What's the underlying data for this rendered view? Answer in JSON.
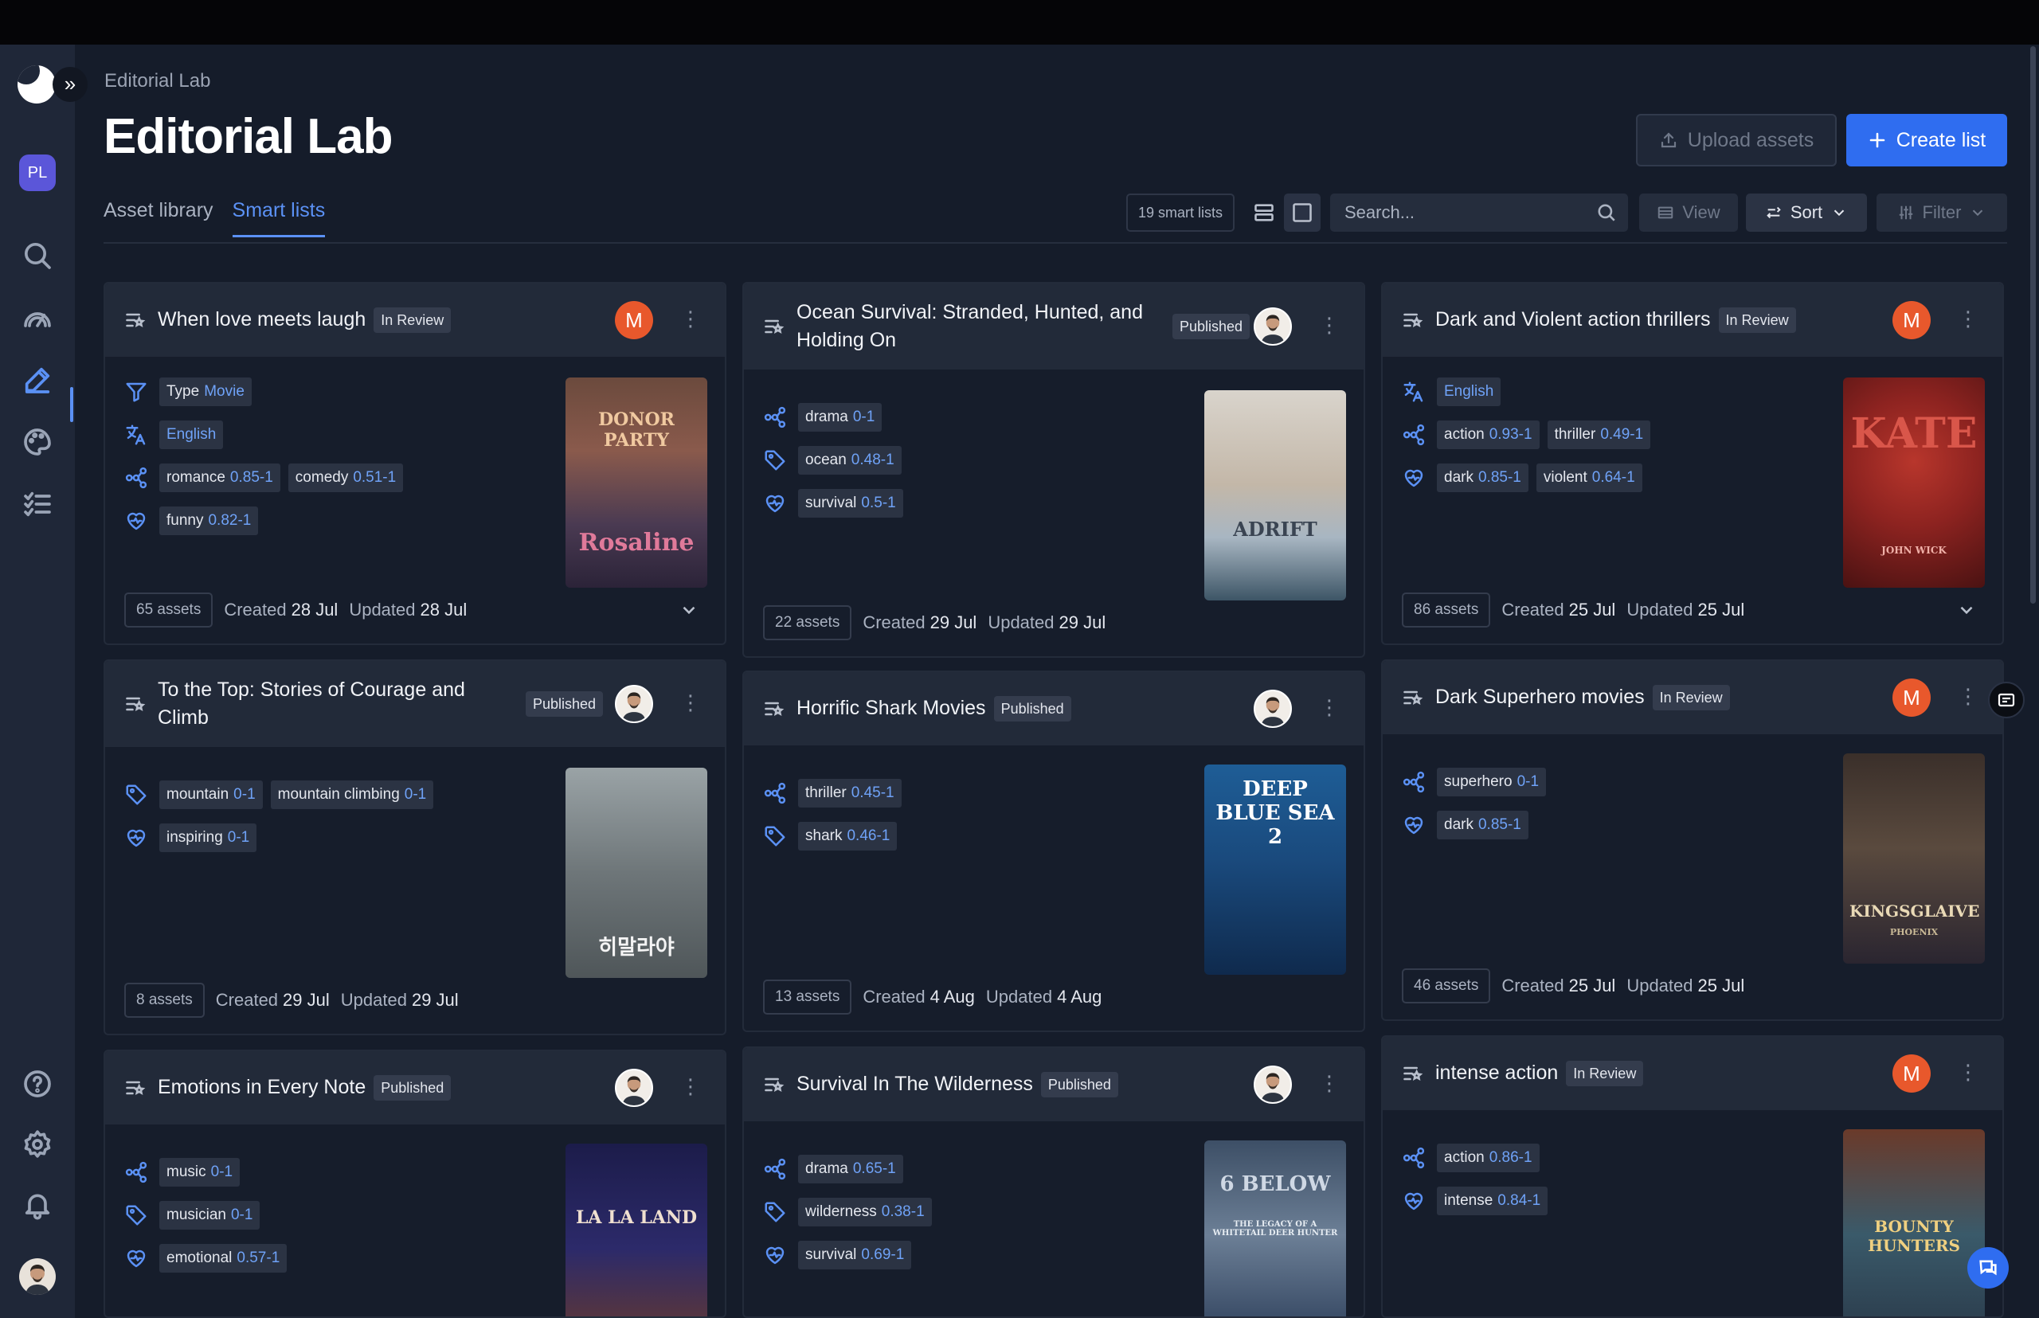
{
  "breadcrumb": "Editorial Lab",
  "page_title": "Editorial Lab",
  "header_actions": {
    "upload": "Upload assets",
    "create": "Create list"
  },
  "sidebar": {
    "workspace_initials": "PL"
  },
  "tabs": [
    {
      "label": "Asset library",
      "active": false
    },
    {
      "label": "Smart lists",
      "active": true
    }
  ],
  "toolbar": {
    "smart_list_count": "19 smart lists",
    "search_placeholder": "Search...",
    "view_label": "View",
    "sort_label": "Sort",
    "filter_label": "Filter"
  },
  "cards": [
    {
      "title": "When love meets laugh",
      "status": "In Review",
      "owner_initial": "M",
      "rows": [
        {
          "icon": "filter-icon",
          "chips": [
            {
              "label": "Type",
              "value": "Movie"
            }
          ]
        },
        {
          "icon": "language-icon",
          "chips": [
            {
              "label": "English"
            }
          ]
        },
        {
          "icon": "genre-icon",
          "chips": [
            {
              "label": "romance",
              "value": "0.85-1"
            },
            {
              "label": "comedy",
              "value": "0.51-1"
            }
          ]
        },
        {
          "icon": "mood-icon",
          "chips": [
            {
              "label": "funny",
              "value": "0.82-1"
            }
          ]
        }
      ],
      "poster": {
        "top_text": "DONOR PARTY",
        "bottom_text": "Rosaline"
      },
      "assets": "65 assets",
      "created_label": "Created",
      "created": "28 Jul",
      "updated_label": "Updated",
      "updated": "28 Jul"
    },
    {
      "title": "Ocean Survival: Stranded, Hunted, and Holding On",
      "status": "Published",
      "rows": [
        {
          "icon": "genre-icon",
          "chips": [
            {
              "label": "drama",
              "value": "0-1"
            }
          ]
        },
        {
          "icon": "tag-icon",
          "chips": [
            {
              "label": "ocean",
              "value": "0.48-1"
            }
          ]
        },
        {
          "icon": "mood-icon",
          "chips": [
            {
              "label": "survival",
              "value": "0.5-1"
            }
          ]
        }
      ],
      "poster": {
        "text": "ADRIFT"
      },
      "assets": "22 assets",
      "created_label": "Created",
      "created": "29 Jul",
      "updated_label": "Updated",
      "updated": "29 Jul"
    },
    {
      "title": "Dark and Violent action thrillers",
      "status": "In Review",
      "owner_initial": "M",
      "rows": [
        {
          "icon": "language-icon",
          "chips": [
            {
              "label": "English"
            }
          ]
        },
        {
          "icon": "genre-icon",
          "chips": [
            {
              "label": "action",
              "value": "0.93-1"
            },
            {
              "label": "thriller",
              "value": "0.49-1"
            }
          ]
        },
        {
          "icon": "mood-icon",
          "chips": [
            {
              "label": "dark",
              "value": "0.85-1"
            },
            {
              "label": "violent",
              "value": "0.64-1"
            }
          ]
        }
      ],
      "poster": {
        "text": "KATE",
        "sub": "JOHN WICK"
      },
      "assets": "86 assets",
      "created_label": "Created",
      "created": "25 Jul",
      "updated_label": "Updated",
      "updated": "25 Jul"
    },
    {
      "title": "To the Top: Stories of Courage and Climb",
      "status": "Published",
      "rows": [
        {
          "icon": "tag-icon",
          "chips": [
            {
              "label": "mountain",
              "value": "0-1"
            },
            {
              "label": "mountain climbing",
              "value": "0-1"
            }
          ]
        },
        {
          "icon": "mood-icon",
          "chips": [
            {
              "label": "inspiring",
              "value": "0-1"
            }
          ]
        }
      ],
      "poster": {
        "text": "히말라야"
      },
      "assets": "8 assets",
      "created_label": "Created",
      "created": "29 Jul",
      "updated_label": "Updated",
      "updated": "29 Jul"
    },
    {
      "title": "Horrific Shark Movies",
      "status": "Published",
      "rows": [
        {
          "icon": "genre-icon",
          "chips": [
            {
              "label": "thriller",
              "value": "0.45-1"
            }
          ]
        },
        {
          "icon": "tag-icon",
          "chips": [
            {
              "label": "shark",
              "value": "0.46-1"
            }
          ]
        }
      ],
      "poster": {
        "text": "DEEP BLUE SEA 2"
      },
      "assets": "13 assets",
      "created_label": "Created",
      "created": "4 Aug",
      "updated_label": "Updated",
      "updated": "4 Aug"
    },
    {
      "title": "Dark Superhero movies",
      "status": "In Review",
      "owner_initial": "M",
      "rows": [
        {
          "icon": "genre-icon",
          "chips": [
            {
              "label": "superhero",
              "value": "0-1"
            }
          ]
        },
        {
          "icon": "mood-icon",
          "chips": [
            {
              "label": "dark",
              "value": "0.85-1"
            }
          ]
        }
      ],
      "poster": {
        "text": "KINGSGLAIVE",
        "sub": "PHOENIX"
      },
      "assets": "46 assets",
      "created_label": "Created",
      "created": "25 Jul",
      "updated_label": "Updated",
      "updated": "25 Jul"
    },
    {
      "title": "Emotions in Every Note",
      "status": "Published",
      "rows": [
        {
          "icon": "genre-icon",
          "chips": [
            {
              "label": "music",
              "value": "0-1"
            }
          ]
        },
        {
          "icon": "tag-icon",
          "chips": [
            {
              "label": "musician",
              "value": "0-1"
            }
          ]
        },
        {
          "icon": "mood-icon",
          "chips": [
            {
              "label": "emotional",
              "value": "0.57-1"
            }
          ]
        }
      ],
      "poster": {
        "text": "LA LA LAND"
      }
    },
    {
      "title": "Survival In The Wilderness",
      "status": "Published",
      "rows": [
        {
          "icon": "genre-icon",
          "chips": [
            {
              "label": "drama",
              "value": "0.65-1"
            }
          ]
        },
        {
          "icon": "tag-icon",
          "chips": [
            {
              "label": "wilderness",
              "value": "0.38-1"
            }
          ]
        },
        {
          "icon": "mood-icon",
          "chips": [
            {
              "label": "survival",
              "value": "0.69-1"
            }
          ]
        }
      ],
      "poster": {
        "text": "6 BELOW",
        "sub": "THE LEGACY OF A WHITETAIL DEER HUNTER"
      }
    },
    {
      "title": "intense action",
      "status": "In Review",
      "owner_initial": "M",
      "rows": [
        {
          "icon": "genre-icon",
          "chips": [
            {
              "label": "action",
              "value": "0.86-1"
            }
          ]
        },
        {
          "icon": "mood-icon",
          "chips": [
            {
              "label": "intense",
              "value": "0.84-1"
            }
          ]
        }
      ],
      "poster": {
        "text": "BOUNTY HUNTERS"
      }
    }
  ]
}
